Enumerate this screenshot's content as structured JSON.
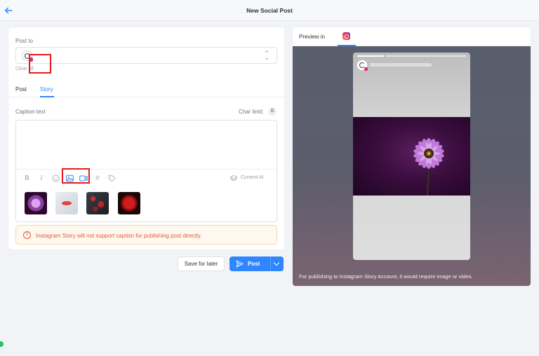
{
  "header": {
    "title": "New Social Post"
  },
  "form": {
    "post_to_label": "Post to",
    "clear_all": "Clear all",
    "tabs": [
      {
        "label": "Post"
      },
      {
        "label": "Story"
      }
    ],
    "active_tab": "Story",
    "caption_label": "Caption text",
    "char_limit_label": "Char limit:",
    "char_count": "0",
    "caption_value": "",
    "toolbar": {
      "bold": "B",
      "italic": "I",
      "hashtag": "#",
      "content_ai": "Content AI"
    },
    "media": [
      {
        "name": "purple-daisy"
      },
      {
        "name": "red-object-on-grey"
      },
      {
        "name": "red-leaves-dark"
      },
      {
        "name": "red-leaf"
      }
    ],
    "warning": "Instagram Story will not support caption for publishing post directly.",
    "warning_icon": "!",
    "save_label": "Save for later",
    "post_label": "Post"
  },
  "preview": {
    "label": "Preview in",
    "network_icon": "instagram-icon",
    "note": "For publishing to Instagram Story Account, it would require image or video."
  },
  "colors": {
    "accent": "#2f86ff",
    "warning": "#e05a3a",
    "highlight": "#e11d1d"
  }
}
